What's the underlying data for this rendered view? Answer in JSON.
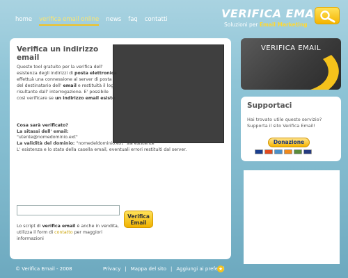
{
  "nav": {
    "items": [
      {
        "label": "home"
      },
      {
        "label": "verifica email online"
      },
      {
        "label": "news"
      },
      {
        "label": "faq"
      },
      {
        "label": "contatti"
      }
    ],
    "active_index": 1
  },
  "logo": {
    "title": "VERIFICA EMAIL",
    "subtitle_prefix": "Soluzioni per ",
    "subtitle_highlight": "Email Marketing",
    "icon": "magnifier-icon"
  },
  "main": {
    "title": "Verifica un indirizzo email",
    "intro": {
      "t1": "Questo tool gratuito per la verifica dell' esistenza degli indirizzi di ",
      "b1": "posta elettronica",
      "t2": " effettuà una connessione al server di posta del destinatario dell' ",
      "b2": "email",
      "t3": " e restituità il log risultante dall' interrogazione. E' possibile così verificare se ",
      "b3": "un indirizzo email esiste",
      "t4": "."
    },
    "detail": {
      "question": "Cosa sarà verificato?",
      "syntax_label": "La sitassi dell' email:",
      "syntax_value": "\"utente@nomedominio.ext\"",
      "domain_label": "La validità del dominio:",
      "domain_value": " \"nomedeldominio.ext\" sia esistente",
      "existence": "L' esistenza e lo stato della casella email, eventuali errori restituiti dal server."
    },
    "email_input_value": "",
    "verify_button": "Verifica Email",
    "footnote": {
      "t1": "Lo script di ",
      "b1": "verifica email",
      "t2": " è anche in vendita, utilizza il form di ",
      "link": "contatto",
      "t3": " per maggiori informazioni"
    }
  },
  "promo": {
    "title": "VERIFICA EMAIL"
  },
  "support": {
    "title": "Supportaci",
    "text": "Hai trovato utile questo servizio? Supporta il sito Verifica Email!",
    "donate_label": "Donazione",
    "cards": [
      {
        "name": "visa",
        "color": "#1a3f8f"
      },
      {
        "name": "mastercard",
        "color": "#e24b1e"
      },
      {
        "name": "amex",
        "color": "#4a90c9"
      },
      {
        "name": "discover",
        "color": "#f08a1c"
      },
      {
        "name": "bank",
        "color": "#5a8c3c"
      },
      {
        "name": "paypal",
        "color": "#253b80"
      }
    ]
  },
  "footer": {
    "copyright": "© Verifica Email - 2008",
    "links": [
      {
        "label": "Privacy"
      },
      {
        "label": "Mappa del sito"
      },
      {
        "label": "Aggiungi ai preferiti"
      }
    ],
    "separator": "|"
  },
  "colors": {
    "accent_yellow": "#f5c21b",
    "link_gold": "#c9a000",
    "dark_panel": "#3a3a3a"
  }
}
